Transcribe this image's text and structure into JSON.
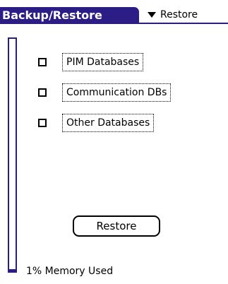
{
  "app": {
    "title": "Backup/Restore",
    "mode_menu": {
      "label": "Restore",
      "icon": "triangle-down-icon"
    }
  },
  "options": [
    {
      "label": "PIM Databases",
      "checked": false
    },
    {
      "label": "Communication DBs",
      "checked": false
    },
    {
      "label": "Other Databases",
      "checked": false
    }
  ],
  "actions": {
    "restore_label": "Restore"
  },
  "memory": {
    "used_percent": 1,
    "status_text": "1% Memory Used"
  },
  "colors": {
    "accent": "#2c1d86",
    "background": "#ffffff",
    "text": "#000000"
  }
}
